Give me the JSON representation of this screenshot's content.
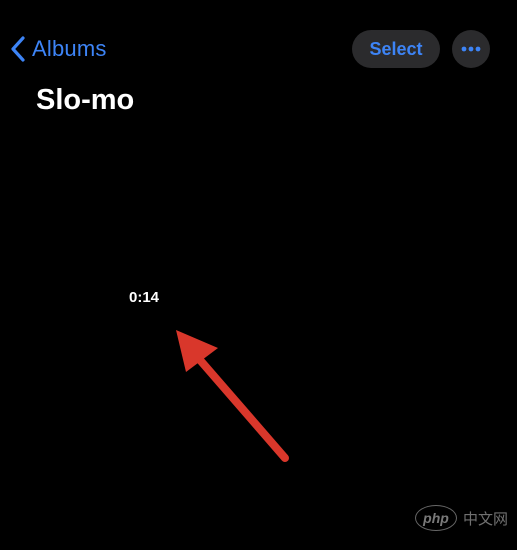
{
  "nav": {
    "back_label": "Albums",
    "select_label": "Select",
    "more_icon": "ellipsis-icon"
  },
  "page": {
    "title": "Slo-mo"
  },
  "video": {
    "duration": "0:14"
  },
  "annotation": {
    "arrow_icon": "red-arrow-icon",
    "arrow_color": "#d9372b"
  },
  "watermark": {
    "badge_text": "php",
    "site_text": "中文网"
  },
  "colors": {
    "accent": "#3d84f6",
    "background": "#000000",
    "button_bg": "#2b2b2d"
  }
}
